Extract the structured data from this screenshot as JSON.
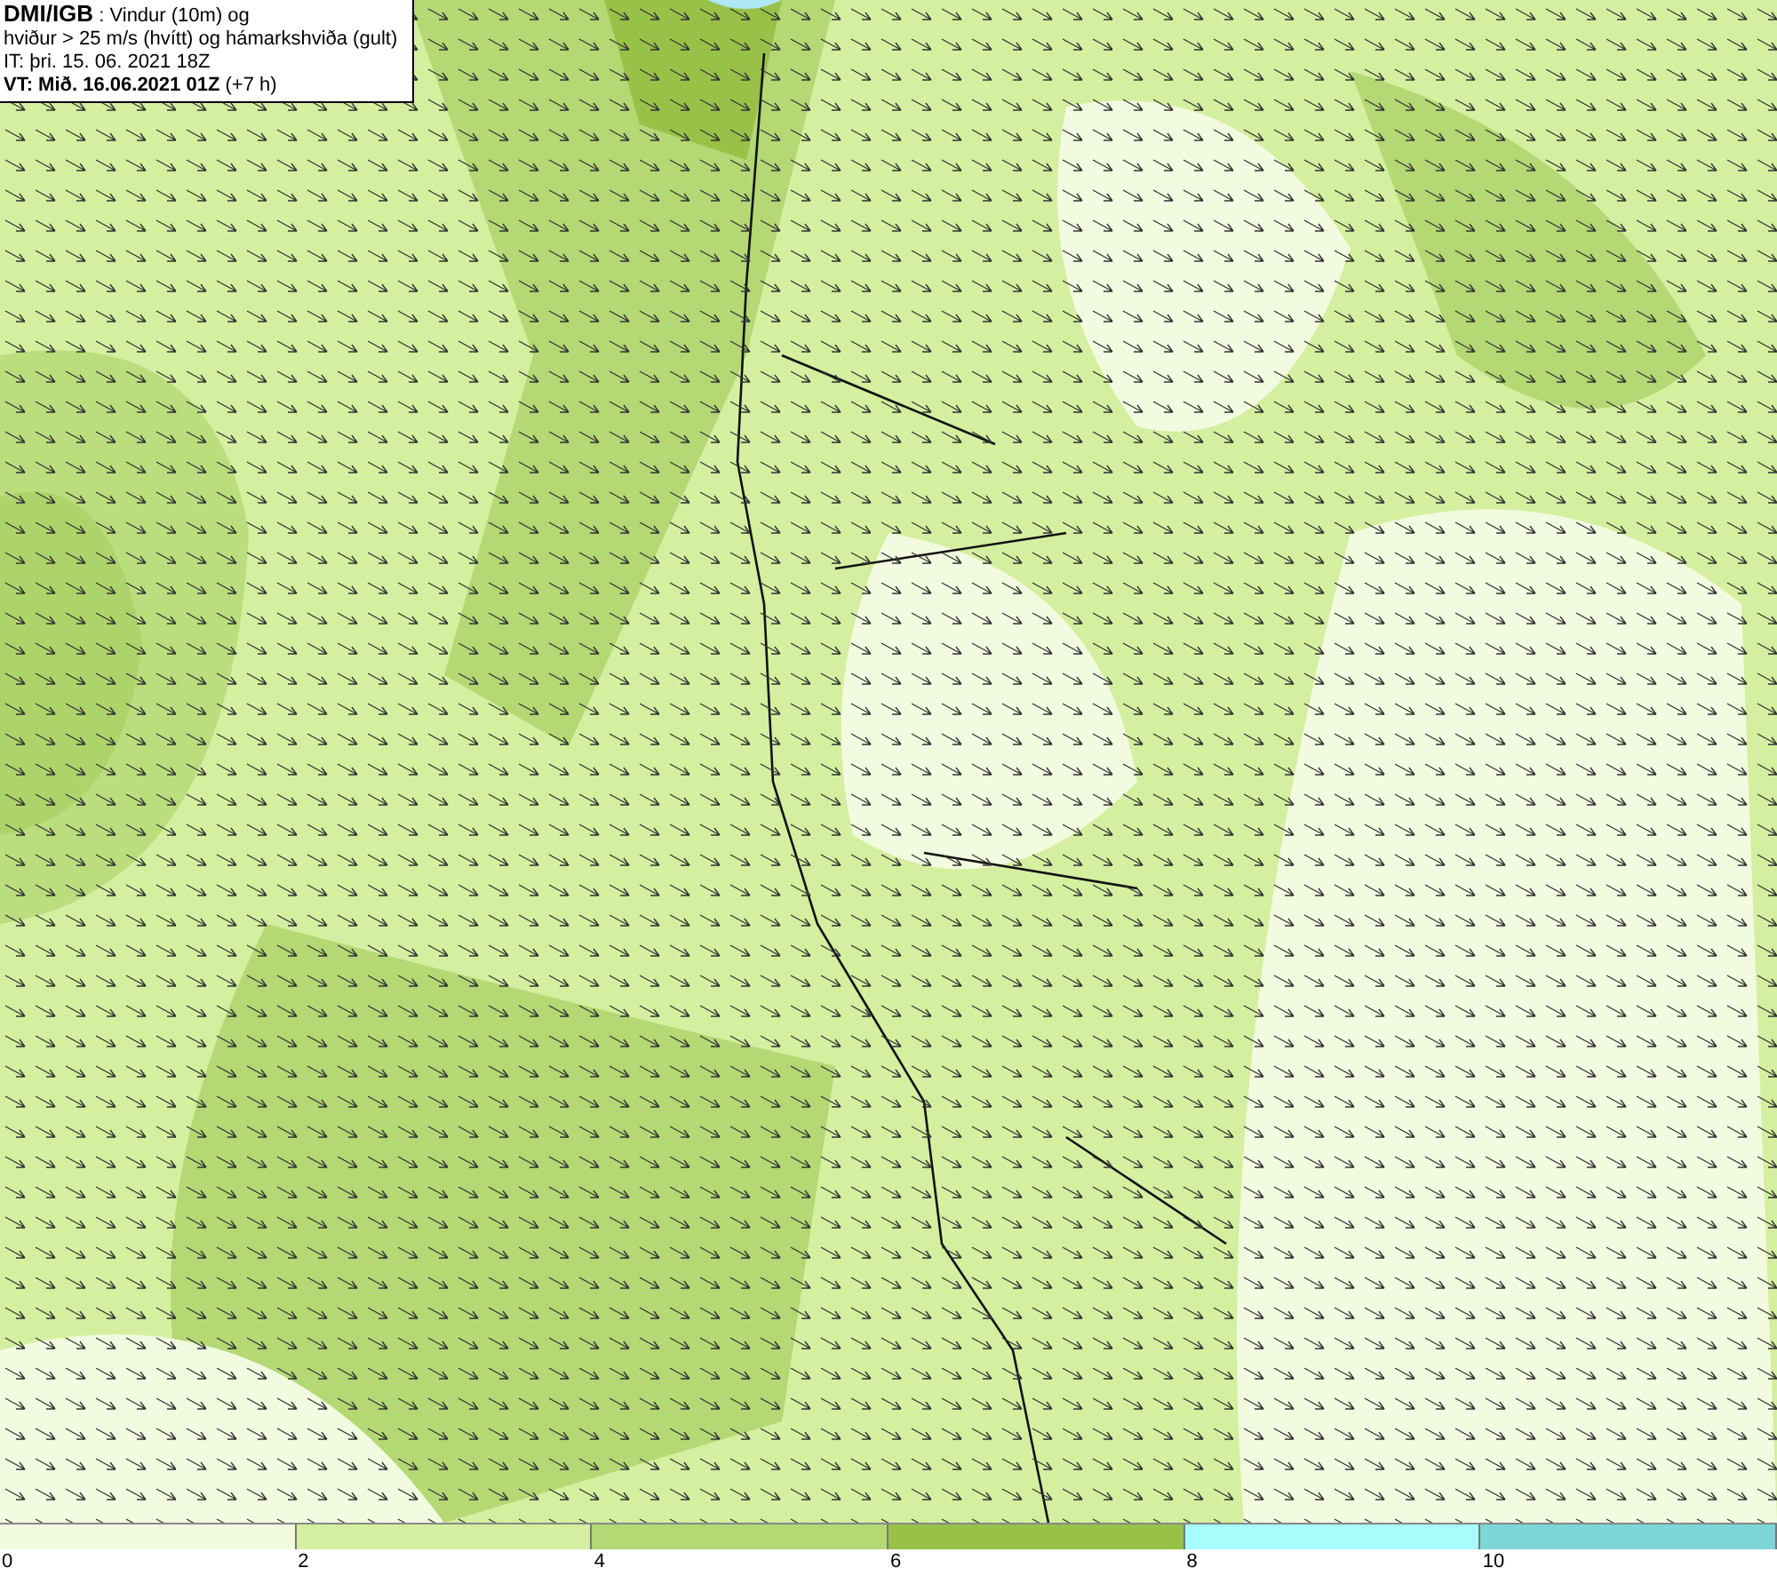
{
  "info_box": {
    "lines": [
      "**DMI/IGB** : Vindur (10m) og",
      "hviður > 25 m/s (hvítt) og hámarkshviða (gult)",
      "IT: þri. 15. 06. 2021 18Z",
      "**VT: Mið. 16.06.2021 01Z** (+7 h)"
    ]
  },
  "legend": {
    "segments": [
      {
        "color": "#f2fbe0"
      },
      {
        "color": "#d4ef9f"
      },
      {
        "color": "#b3d874"
      },
      {
        "color": "#98c148"
      },
      {
        "color": "#a7fdfb"
      },
      {
        "color": "#7dd6d8"
      }
    ],
    "ticks": [
      "0",
      "2",
      "4",
      "6",
      "8",
      "10"
    ]
  }
}
